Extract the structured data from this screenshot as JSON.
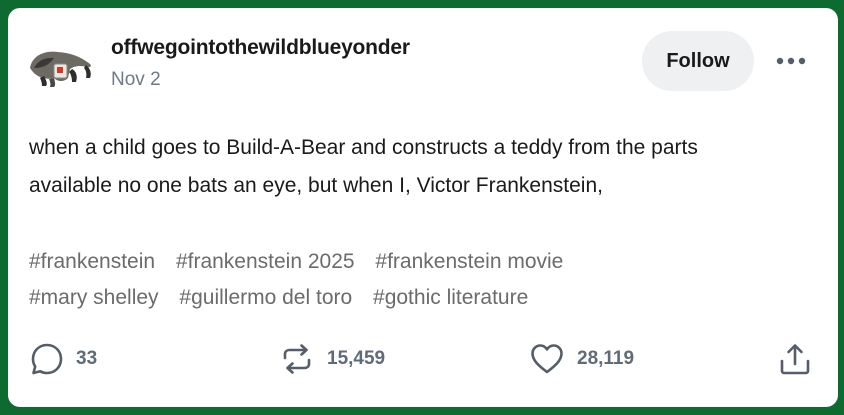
{
  "post": {
    "username": "offwegointothewildblueyonder",
    "date": "Nov 2",
    "follow_label": "Follow",
    "more_icon": "more-horizontal-icon",
    "text_line1": "when a child goes to Build-A-Bear and constructs a teddy from the parts",
    "text_line2": "available no one bats an eye, but when I, Victor Frankenstein,",
    "tags_row1": [
      "#frankenstein",
      "#frankenstein 2025",
      "#frankenstein movie"
    ],
    "tags_row2": [
      "#mary shelley",
      "#guillermo del toro",
      "#gothic literature"
    ]
  },
  "actions": {
    "comments": "33",
    "reblogs": "15,459",
    "likes": "28,119",
    "comment_icon": "comment-bubble-icon",
    "reblog_icon": "reblog-icon",
    "like_icon": "heart-icon",
    "share_icon": "share-icon"
  },
  "colors": {
    "background": "#0d6b32",
    "card": "#ffffff",
    "text": "#1a1a1a",
    "muted": "#6e7a86",
    "tag": "#6b6b6b"
  }
}
